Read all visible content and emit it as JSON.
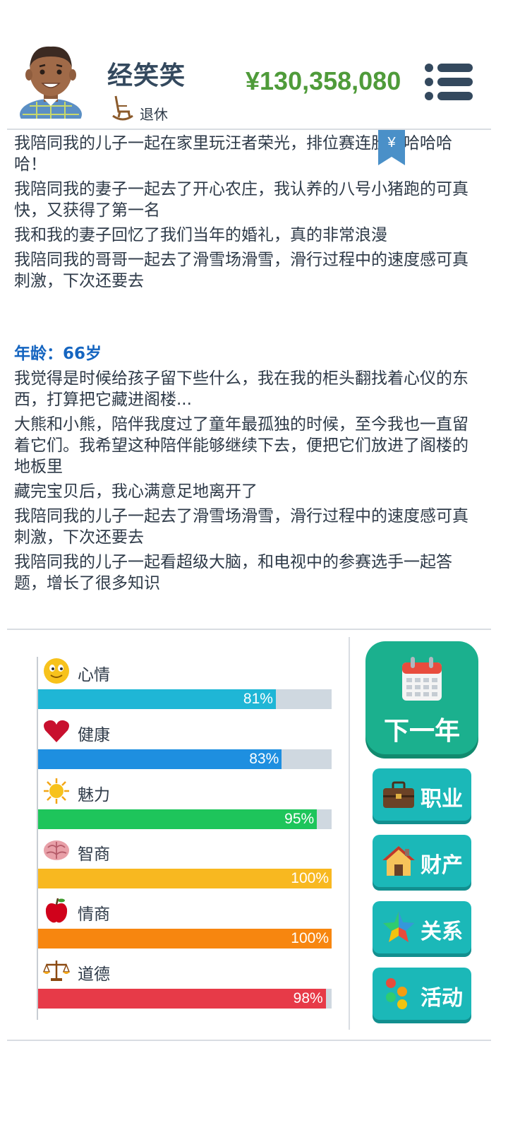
{
  "header": {
    "name": "经笑笑",
    "status": "退休",
    "money": "¥130,358,080"
  },
  "log": {
    "entries_before": [
      "我陪同我的儿子一起在家里玩汪者荣光，排位赛连胜哈哈哈哈哈！",
      "我陪同我的妻子一起去了开心农庄，我认养的八号小猪跑的可真快，又获得了第一名",
      "我和我的妻子回忆了我们当年的婚礼，真的非常浪漫",
      "我陪同我的哥哥一起去了滑雪场滑雪，滑行过程中的速度感可真刺激，下次还要去"
    ],
    "age_label": "年龄：66岁",
    "entries_after": [
      "我觉得是时候给孩子留下些什么，我在我的柜头翻找着心仪的东西，打算把它藏进阁楼...",
      "大熊和小熊，陪伴我度过了童年最孤独的时候，至今我也一直留着它们。我希望这种陪伴能够继续下去，便把它们放进了阁楼的地板里",
      "藏完宝贝后，我心满意足地离开了",
      "我陪同我的儿子一起去了滑雪场滑雪，滑行过程中的速度感可真刺激，下次还要去",
      "我陪同我的儿子一起看超级大脑，和电视中的参赛选手一起答题，增长了很多知识"
    ]
  },
  "stats": [
    {
      "label": "心情",
      "value": "81%",
      "fraction": 0.81,
      "color": "#1fb6d6",
      "icon": "smiley-icon"
    },
    {
      "label": "健康",
      "value": "83%",
      "fraction": 0.83,
      "color": "#1e8fe0",
      "icon": "heart-icon"
    },
    {
      "label": "魅力",
      "value": "95%",
      "fraction": 0.95,
      "color": "#1ec55b",
      "icon": "sun-icon"
    },
    {
      "label": "智商",
      "value": "100%",
      "fraction": 1.0,
      "color": "#f8b820",
      "icon": "brain-icon"
    },
    {
      "label": "情商",
      "value": "100%",
      "fraction": 1.0,
      "color": "#f7860f",
      "icon": "apple-icon"
    },
    {
      "label": "道德",
      "value": "98%",
      "fraction": 0.98,
      "color": "#e73a48",
      "icon": "scales-icon"
    }
  ],
  "actions": {
    "next_year": "下一年",
    "career": "职业",
    "property": "财产",
    "relations": "关系",
    "activities": "活动"
  }
}
